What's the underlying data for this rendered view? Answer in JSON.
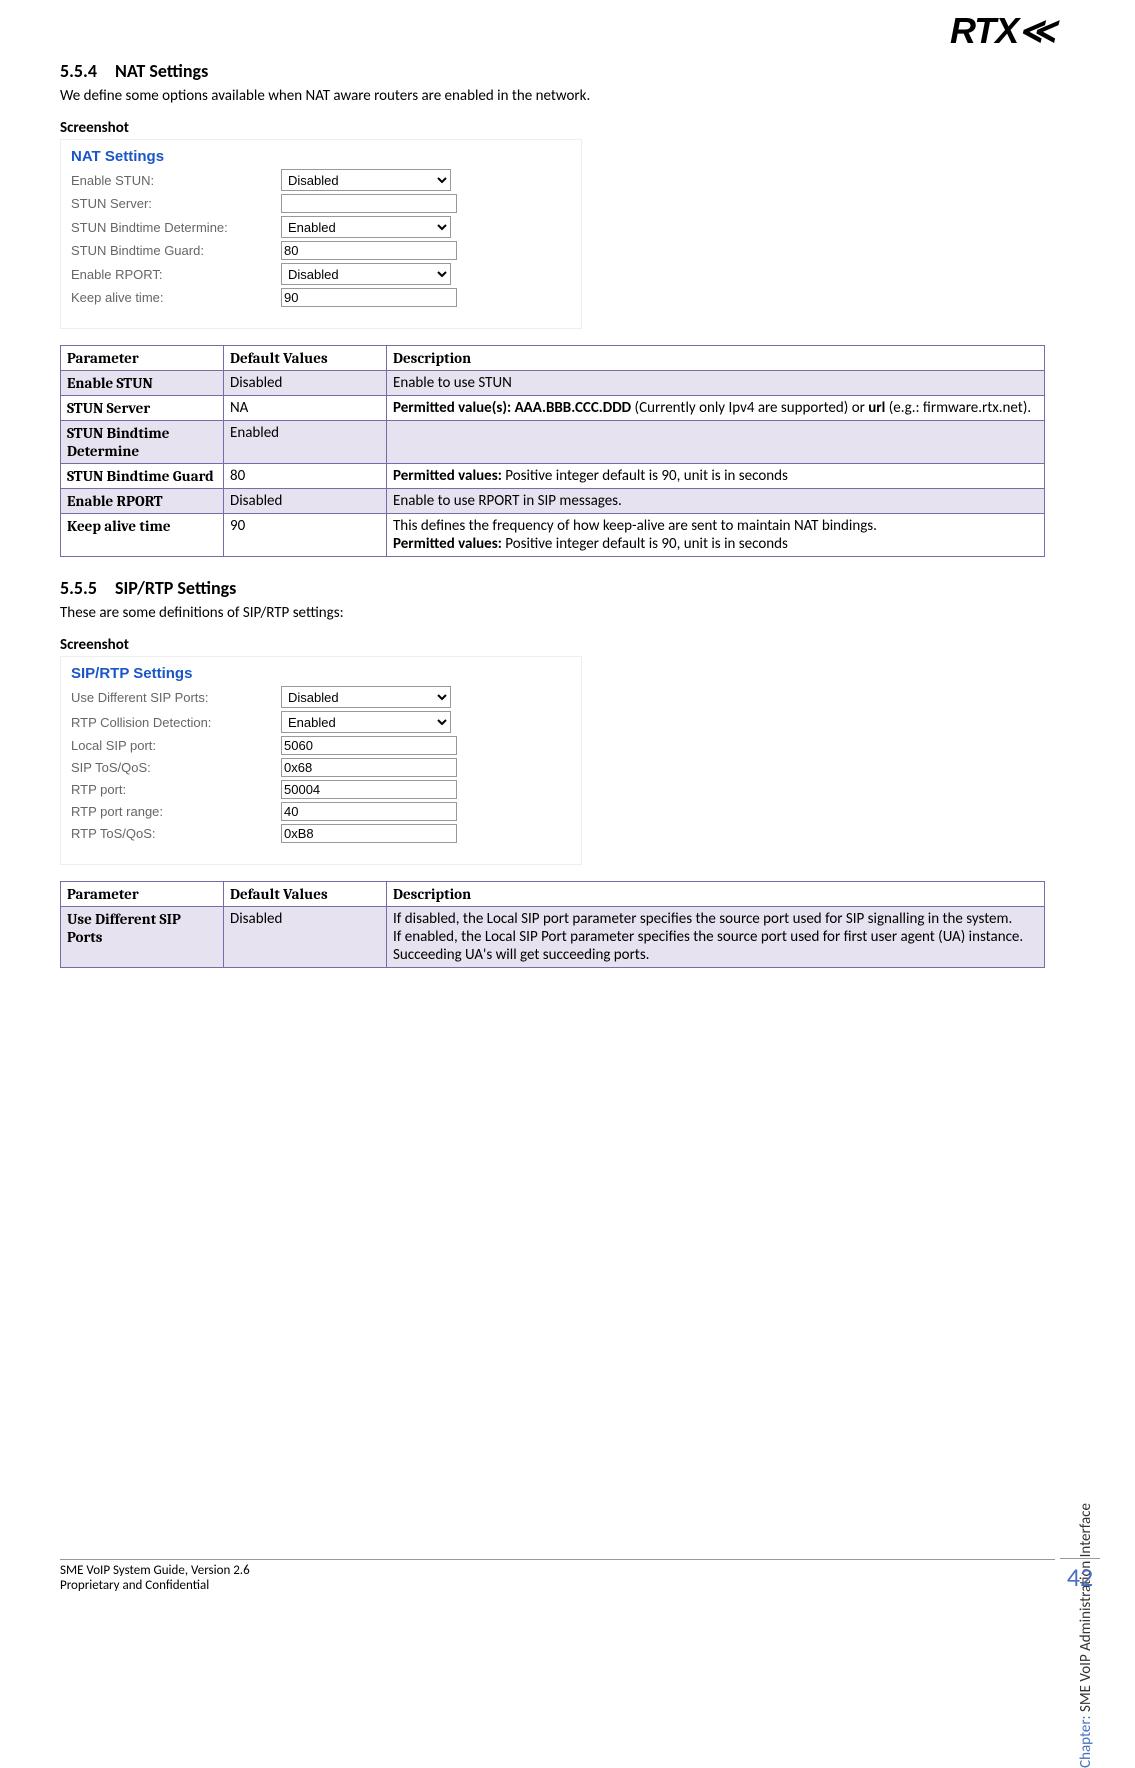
{
  "logo_text": "RTX",
  "section1": {
    "num": "5.5.4",
    "title": "NAT Settings",
    "intro": "We define some options available when NAT aware routers are enabled in the network.",
    "screenshot_label": "Screenshot",
    "panel_title": "NAT Settings",
    "form": {
      "r0": {
        "label": "Enable STUN:",
        "value": "Disabled"
      },
      "r1": {
        "label": "STUN Server:",
        "value": ""
      },
      "r2": {
        "label": "STUN Bindtime Determine:",
        "value": "Enabled"
      },
      "r3": {
        "label": "STUN Bindtime Guard:",
        "value": "80"
      },
      "r4": {
        "label": "Enable RPORT:",
        "value": "Disabled"
      },
      "r5": {
        "label": "Keep alive time:",
        "value": "90"
      }
    }
  },
  "table1": {
    "headers": {
      "h0": "Parameter",
      "h1": "Default Values",
      "h2": "Description"
    },
    "rows": {
      "r0": {
        "p": "Enable STUN",
        "d": "Disabled",
        "desc": "Enable to use STUN"
      },
      "r1": {
        "p": "STUN Server",
        "d": "NA",
        "desc_prefix": "Permitted value(s): AAA.BBB.CCC.DDD",
        "desc_rest": " (Currently only Ipv4 are supported) or ",
        "desc_bold2": "url",
        "desc_tail": "   (e.g.: firmware.rtx.net)."
      },
      "r2": {
        "p": "STUN Bindtime Determine",
        "d": "Enabled",
        "desc": ""
      },
      "r3": {
        "p": "STUN Bindtime Guard",
        "d": "80",
        "desc_prefix": "Permitted values:",
        "desc_rest": " Positive integer default is 90, unit is in seconds"
      },
      "r4": {
        "p": "Enable RPORT",
        "d": "Disabled",
        "desc": "Enable to use RPORT in SIP messages."
      },
      "r5": {
        "p": "Keep alive time",
        "d": "90",
        "desc_line1": "This defines the frequency of how keep-alive are sent to maintain NAT bindings.",
        "desc_prefix": "Permitted values:",
        "desc_rest": " Positive integer default is 90, unit is in seconds"
      }
    }
  },
  "section2": {
    "num": "5.5.5",
    "title": "SIP/RTP Settings",
    "intro": "These are some definitions of SIP/RTP settings:",
    "screenshot_label": "Screenshot",
    "panel_title": "SIP/RTP Settings",
    "form": {
      "r0": {
        "label": "Use Different SIP Ports:",
        "value": "Disabled"
      },
      "r1": {
        "label": "RTP Collision Detection:",
        "value": "Enabled"
      },
      "r2": {
        "label": "Local SIP port:",
        "value": "5060"
      },
      "r3": {
        "label": "SIP ToS/QoS:",
        "value": "0x68"
      },
      "r4": {
        "label": "RTP port:",
        "value": "50004"
      },
      "r5": {
        "label": "RTP port range:",
        "value": "40"
      },
      "r6": {
        "label": "RTP ToS/QoS:",
        "value": "0xB8"
      }
    }
  },
  "table2": {
    "headers": {
      "h0": "Parameter",
      "h1": "Default Values",
      "h2": "Description"
    },
    "rows": {
      "r0": {
        "p": "Use Different SIP Ports",
        "d": "Disabled",
        "desc": "If disabled, the Local SIP port parameter specifies the source port used for SIP signalling in the system.\nIf enabled, the Local SIP Port parameter specifies the source port used for first user agent (UA) instance. Succeeding UA's will get succeeding ports."
      }
    }
  },
  "side": {
    "chapter_label": "Chapter:",
    "chapter_text": " SME VoIP Administration Interface"
  },
  "footer": {
    "line1": "SME VoIP System Guide, Version 2.6",
    "line2": "Proprietary and Confidential"
  },
  "page_num": "42"
}
